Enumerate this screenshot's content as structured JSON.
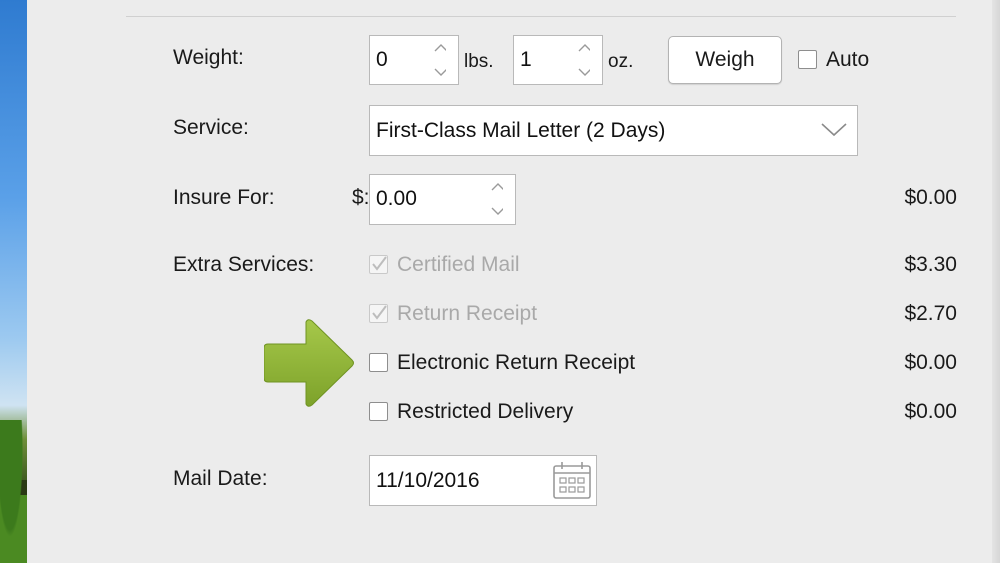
{
  "form": {
    "weight": {
      "label": "Weight:",
      "lbs_value": "0",
      "lbs_unit": "lbs.",
      "oz_value": "1",
      "oz_unit": "oz.",
      "weigh_button": "Weigh",
      "auto_label": "Auto",
      "auto_checked": false
    },
    "service": {
      "label": "Service:",
      "selected": "First-Class Mail Letter (2 Days)"
    },
    "insure": {
      "label": "Insure For:",
      "currency": "$:",
      "value": "0.00",
      "price": "$0.00"
    },
    "extra_services": {
      "label": "Extra Services:",
      "items": [
        {
          "label": "Certified Mail",
          "price": "$3.30",
          "checked": true,
          "disabled": true
        },
        {
          "label": "Return Receipt",
          "price": "$2.70",
          "checked": true,
          "disabled": true
        },
        {
          "label": "Electronic Return Receipt",
          "price": "$0.00",
          "checked": false,
          "disabled": false
        },
        {
          "label": "Restricted Delivery",
          "price": "$0.00",
          "checked": false,
          "disabled": false
        }
      ]
    },
    "mail_date": {
      "label": "Mail Date:",
      "value": "11/10/2016"
    }
  },
  "colors": {
    "arrow": "#8db33a",
    "panel_bg": "#ececec"
  },
  "icons": [
    "chevron-up-icon",
    "chevron-down-icon",
    "checkmark-icon",
    "calendar-icon",
    "pointer-arrow-icon"
  ]
}
